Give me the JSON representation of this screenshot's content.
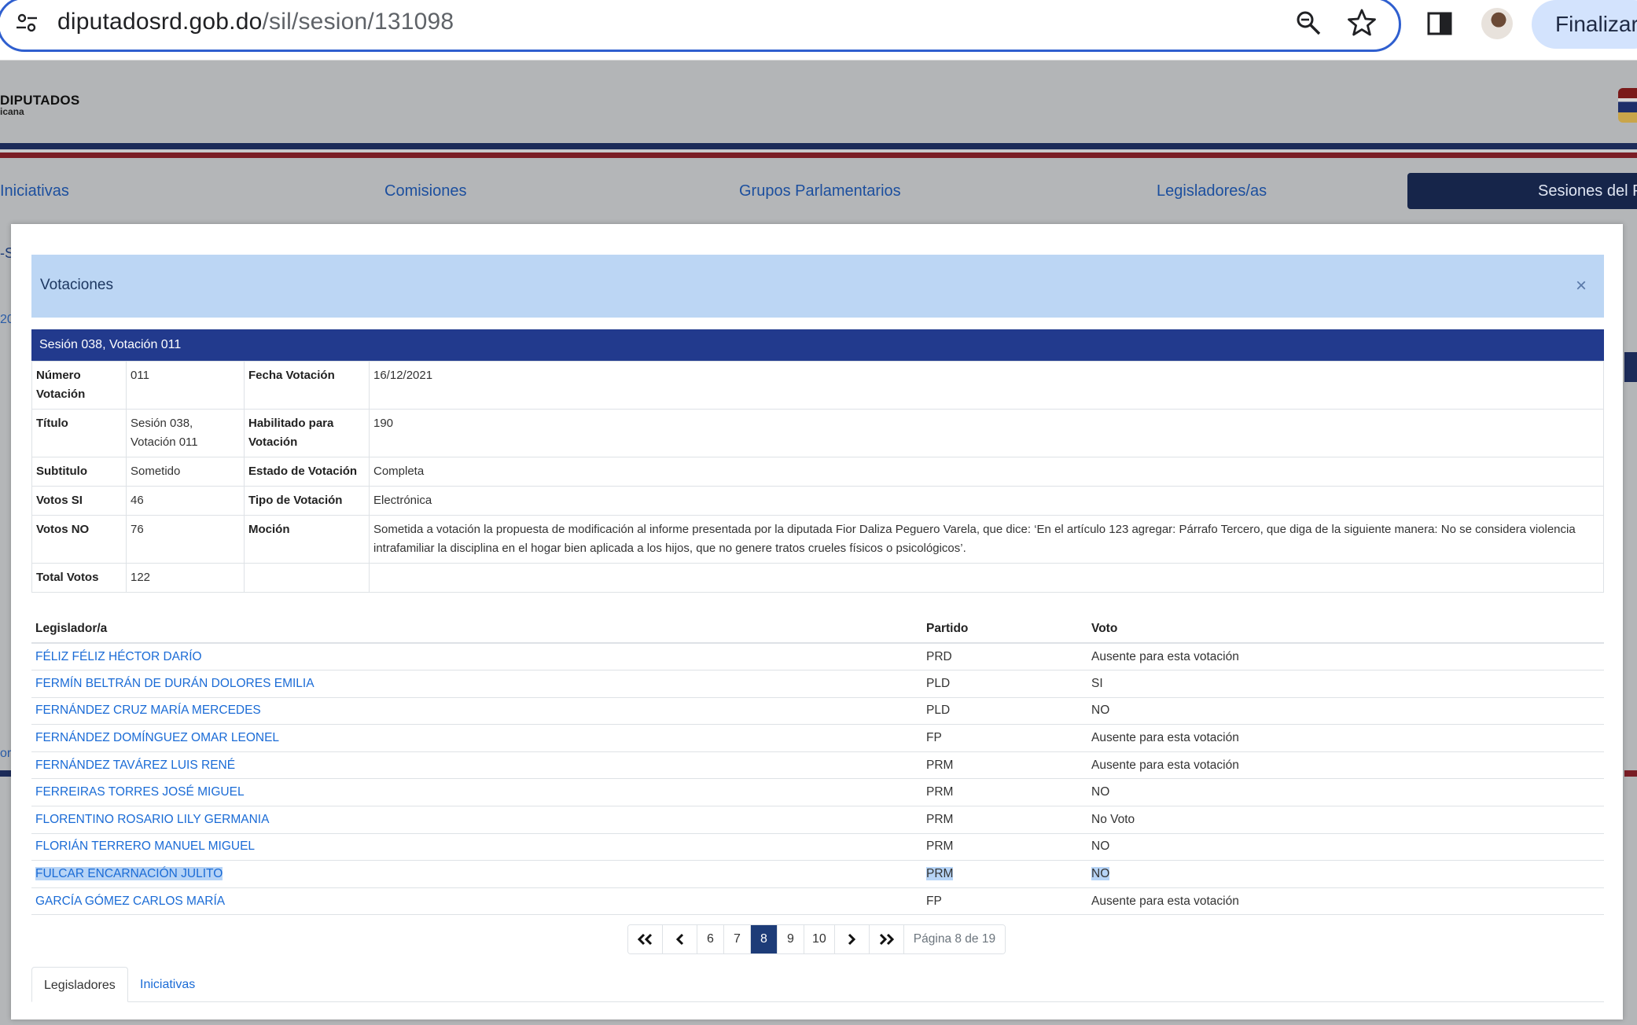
{
  "browser": {
    "url_domain": "diputadosrd.gob.do",
    "url_path": "/sil/sesion/131098",
    "profile_button": "Finalizar"
  },
  "site": {
    "logo_text": "DIPUTADOS",
    "logo_sub": "icana",
    "nav": [
      "Iniciativas",
      "Comisiones",
      "Grupos Parlamentarios",
      "Legisladores/as"
    ],
    "nav_active": "Sesiones del P",
    "fragments": [
      "-S",
      "20",
      "or"
    ]
  },
  "modal": {
    "title": "Votaciones",
    "close_symbol": "×",
    "session_bar": "Sesión 038, Votación 011",
    "info": {
      "numero_label": "Número Votación",
      "numero_value": "011",
      "fecha_label": "Fecha Votación",
      "fecha_value": "16/12/2021",
      "titulo_label": "Título",
      "titulo_value": "Sesión 038, Votación 011",
      "habilitado_label": "Habilitado para Votación",
      "habilitado_value": "190",
      "subtitulo_label": "Subtitulo",
      "subtitulo_value": "Sometido",
      "estado_label": "Estado de Votación",
      "estado_value": "Completa",
      "votos_si_label": "Votos SI",
      "votos_si_value": "46",
      "tipo_label": "Tipo de Votación",
      "tipo_value": "Electrónica",
      "votos_no_label": "Votos NO",
      "votos_no_value": "76",
      "mocion_label": "Moción",
      "mocion_value": "Sometida a votación la propuesta de modificación al informe presentada por la diputada Fior Daliza Peguero Varela, que dice: ‘En el artículo 123 agregar: Párrafo Tercero, que diga de la siguiente manera: No se considera violencia intrafamiliar la disciplina en el hogar bien aplicada a los hijos, que no genere tratos crueles físicos o psicológicos’.",
      "total_label": "Total Votos",
      "total_value": "122"
    },
    "legislators": {
      "headers": [
        "Legislador/a",
        "Partido",
        "Voto"
      ],
      "rows": [
        {
          "name": "FÉLIZ FÉLIZ HÉCTOR DARÍO",
          "partido": "PRD",
          "voto": "Ausente para esta votación"
        },
        {
          "name": "FERMÍN BELTRÁN DE DURÁN DOLORES EMILIA",
          "partido": "PLD",
          "voto": "SI"
        },
        {
          "name": "FERNÁNDEZ CRUZ MARÍA MERCEDES",
          "partido": "PLD",
          "voto": "NO"
        },
        {
          "name": "FERNÁNDEZ DOMÍNGUEZ OMAR LEONEL",
          "partido": "FP",
          "voto": "Ausente para esta votación"
        },
        {
          "name": "FERNÁNDEZ TAVÁREZ LUIS RENÉ",
          "partido": "PRM",
          "voto": "Ausente para esta votación"
        },
        {
          "name": "FERREIRAS TORRES JOSÉ MIGUEL",
          "partido": "PRM",
          "voto": "NO"
        },
        {
          "name": "FLORENTINO ROSARIO LILY GERMANIA",
          "partido": "PRM",
          "voto": "No Voto"
        },
        {
          "name": "FLORIÁN TERRERO MANUEL MIGUEL",
          "partido": "PRM",
          "voto": "NO"
        },
        {
          "name": "FULCAR ENCARNACIÓN JULITO",
          "partido": "PRM",
          "voto": "NO"
        },
        {
          "name": "GARCÍA GÓMEZ CARLOS MARÍA",
          "partido": "FP",
          "voto": "Ausente para esta votación"
        }
      ]
    },
    "pager": {
      "pages": [
        "6",
        "7",
        "8",
        "9",
        "10"
      ],
      "info": "Página 8 de 19"
    },
    "tabs": [
      "Legisladores",
      "Iniciativas"
    ]
  }
}
